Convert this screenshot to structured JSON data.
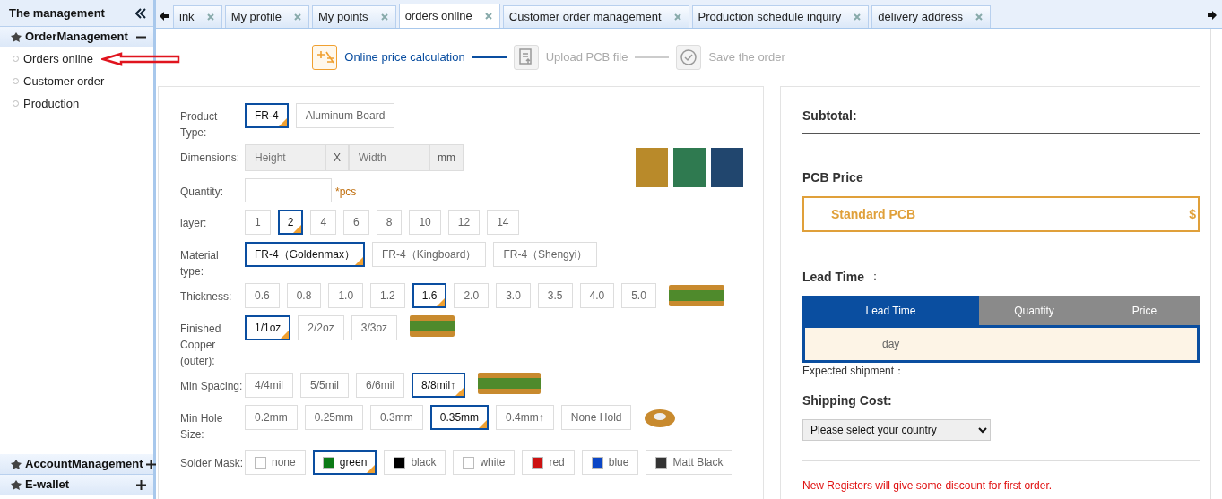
{
  "sidebar": {
    "title": "The management",
    "groups": [
      {
        "label": "OrderManagement",
        "expanded": true,
        "items": [
          {
            "label": "Orders online",
            "annotated": true
          },
          {
            "label": "Customer order",
            "annotated": false
          },
          {
            "label": "Production",
            "annotated": false
          }
        ]
      },
      {
        "label": "AccountManagement",
        "expanded": false
      },
      {
        "label": "E-wallet",
        "expanded": false
      }
    ]
  },
  "tabs": [
    {
      "label": "ink",
      "selected": false
    },
    {
      "label": "My profile",
      "selected": false
    },
    {
      "label": "My points",
      "selected": false
    },
    {
      "label": "orders online",
      "selected": true
    },
    {
      "label": "Customer order management",
      "selected": false
    },
    {
      "label": "Production schedule inquiry",
      "selected": false
    },
    {
      "label": "delivery address",
      "selected": false
    }
  ],
  "steps": [
    {
      "label": "Online price calculation",
      "selected": true
    },
    {
      "label": "Upload PCB file",
      "selected": false
    },
    {
      "label": "Save the order",
      "selected": false
    }
  ],
  "form": [
    {
      "kind": "options",
      "label": "Product Type:",
      "options": [
        {
          "label": "FR-4",
          "selected": true
        },
        {
          "label": "Aluminum Board",
          "selected": false
        }
      ]
    },
    {
      "kind": "dimensions",
      "label": "Dimensions:",
      "height_placeholder": "Height",
      "separator": "X",
      "width_placeholder": "Width",
      "unit": "mm"
    },
    {
      "kind": "quantity",
      "label": "Quantity:",
      "unit": "*pcs"
    },
    {
      "kind": "options",
      "label": "layer:",
      "options": [
        {
          "label": "1",
          "selected": false
        },
        {
          "label": "2",
          "selected": true
        },
        {
          "label": "4",
          "selected": false
        },
        {
          "label": "6",
          "selected": false
        },
        {
          "label": "8",
          "selected": false
        },
        {
          "label": "10",
          "selected": false
        },
        {
          "label": "12",
          "selected": false
        },
        {
          "label": "14",
          "selected": false
        }
      ]
    },
    {
      "kind": "options",
      "label": "Material type:",
      "options": [
        {
          "label": "FR-4（Goldenmax）",
          "selected": true
        },
        {
          "label": "FR-4（Kingboard）",
          "selected": false
        },
        {
          "label": "FR-4（Shengyi）",
          "selected": false
        }
      ]
    },
    {
      "kind": "options",
      "label": "Thickness:",
      "options": [
        {
          "label": "0.6",
          "selected": false
        },
        {
          "label": "0.8",
          "selected": false
        },
        {
          "label": "1.0",
          "selected": false
        },
        {
          "label": "1.2",
          "selected": false
        },
        {
          "label": "1.6",
          "selected": true
        },
        {
          "label": "2.0",
          "selected": false
        },
        {
          "label": "3.0",
          "selected": false
        },
        {
          "label": "3.5",
          "selected": false
        },
        {
          "label": "4.0",
          "selected": false
        },
        {
          "label": "5.0",
          "selected": false
        }
      ]
    },
    {
      "kind": "options",
      "label": "Finished Copper (outer):",
      "options": [
        {
          "label": "1/1oz",
          "selected": true
        },
        {
          "label": "2/2oz",
          "selected": false
        },
        {
          "label": "3/3oz",
          "selected": false
        }
      ]
    },
    {
      "kind": "options",
      "label": "Min Spacing:",
      "options": [
        {
          "label": "4/4mil",
          "selected": false
        },
        {
          "label": "5/5mil",
          "selected": false
        },
        {
          "label": "6/6mil",
          "selected": false
        },
        {
          "label": "8/8mil↑",
          "selected": true
        }
      ]
    },
    {
      "kind": "options",
      "label": "Min Hole Size:",
      "options": [
        {
          "label": "0.2mm",
          "selected": false
        },
        {
          "label": "0.25mm",
          "selected": false
        },
        {
          "label": "0.3mm",
          "selected": false
        },
        {
          "label": "0.35mm",
          "selected": true
        },
        {
          "label": "0.4mm↑",
          "selected": false
        },
        {
          "label": "None Hold",
          "selected": false
        }
      ]
    },
    {
      "kind": "swatches",
      "label": "Solder Mask:",
      "options": [
        {
          "label": "none",
          "selected": false,
          "color": "#ffffff"
        },
        {
          "label": "green",
          "selected": true,
          "color": "#0b7a16"
        },
        {
          "label": "black",
          "selected": false,
          "color": "#000000"
        },
        {
          "label": "white",
          "selected": false,
          "color": "#ffffff"
        },
        {
          "label": "red",
          "selected": false,
          "color": "#cc1111"
        },
        {
          "label": "blue",
          "selected": false,
          "color": "#0b46c6"
        },
        {
          "label": "Matt Black",
          "selected": false,
          "color": "#333333"
        }
      ]
    }
  ],
  "summary": {
    "subtotal_label": "Subtotal:",
    "pcb_price_heading": "PCB Price",
    "pcb_type": "Standard PCB",
    "currency": "$",
    "lead_time_heading": "Lead Time",
    "lead_time_colon": "：",
    "columns": [
      {
        "label": "Lead Time",
        "selected": true
      },
      {
        "label": "Quantity",
        "selected": false
      },
      {
        "label": "Price",
        "selected": false
      }
    ],
    "rows": [
      {
        "lead_time": "day"
      }
    ],
    "expected_shipment": "Expected shipment：",
    "shipping_heading": "Shipping Cost:",
    "country_select": "Please select your country",
    "notice": "New Registers will give some discount for first order."
  }
}
